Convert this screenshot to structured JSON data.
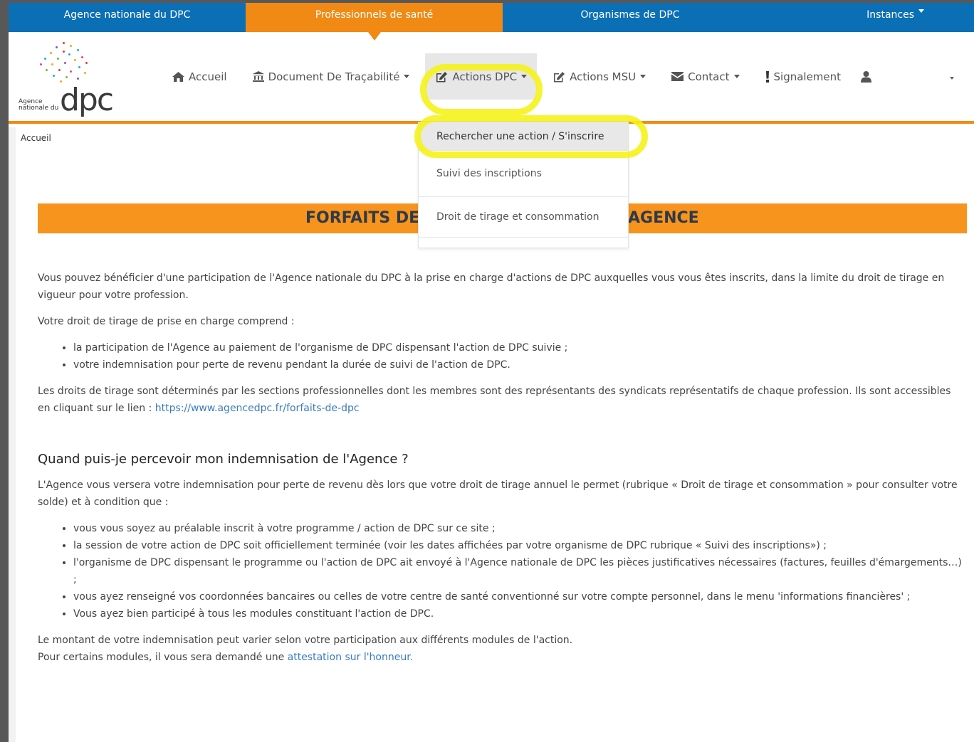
{
  "topbar": {
    "items": [
      {
        "label": "Agence nationale du DPC"
      },
      {
        "label": "Professionnels de santé"
      },
      {
        "label": "Organismes de DPC"
      },
      {
        "label": "Instances"
      }
    ]
  },
  "logo": {
    "text_big": "dpc",
    "text_small": "Agence nationale du"
  },
  "nav": {
    "accueil": "Accueil",
    "document": "Document De Traçabilité",
    "actions_dpc": "Actions DPC",
    "actions_msu": "Actions MSU",
    "contact": "Contact",
    "signalement": "Signalement"
  },
  "dropdown": {
    "items": [
      {
        "label": "Rechercher une action / S'inscrire"
      },
      {
        "label": "Suivi des inscriptions"
      },
      {
        "label": "Droit de tirage et consommation"
      }
    ]
  },
  "breadcrumb": "Accueil",
  "banner": {
    "left": "FORFAITS DE",
    "right": "AGENCE"
  },
  "content": {
    "p1": "Vous pouvez bénéficier d'une participation de l'Agence nationale du DPC à la prise en charge d'actions de DPC auxquelles vous vous êtes inscrits, dans la limite du droit de tirage en vigueur pour votre profession.",
    "p2": "Votre droit de tirage de prise en charge comprend :",
    "list1": [
      "la participation de l'Agence au paiement de l'organisme de DPC dispensant l'action de DPC suivie ;",
      "votre indemnisation pour perte de revenu pendant la durée de suivi de l'action de DPC."
    ],
    "p3": "Les droits de tirage sont déterminés par les sections professionnelles dont les membres sont des représentants des syndicats représentatifs de chaque profession. Ils sont accessibles en cliquant sur le lien :",
    "p3_link": "https://www.agencedpc.fr/forfaits-de-dpc",
    "h3": "Quand puis-je percevoir mon indemnisation de l'Agence ?",
    "p4": "L'Agence vous versera votre indemnisation pour perte de revenu dès lors que votre droit de tirage annuel le permet (rubrique « Droit de tirage et consommation » pour consulter votre solde) et à condition que :",
    "list2": [
      "vous vous soyez au préalable inscrit à votre programme / action de DPC sur ce site ;",
      "la session de votre action de DPC soit officiellement terminée (voir les dates affichées par votre organisme de DPC rubrique « Suivi des inscriptions») ;",
      "l'organisme de DPC dispensant le programme ou l'action de DPC ait envoyé à l'Agence nationale de DPC les pièces justificatives nécessaires (factures, feuilles d'émargements…) ;",
      "vous ayez renseigné vos coordonnées bancaires ou celles de votre centre de santé conventionné sur votre compte personnel, dans le menu 'informations financières' ;",
      "Vous ayez bien participé à tous les modules constituant l'action de DPC."
    ],
    "p5a": "Le montant de votre indemnisation peut varier selon votre participation aux différents modules de l'action.",
    "p5b": "Pour certains modules, il vous sera demandé une",
    "p5_link": "attestation sur l'honneur."
  },
  "colors": {
    "blue": "#0b6fb5",
    "orange": "#f08a14",
    "highlight": "#f5f21b"
  }
}
